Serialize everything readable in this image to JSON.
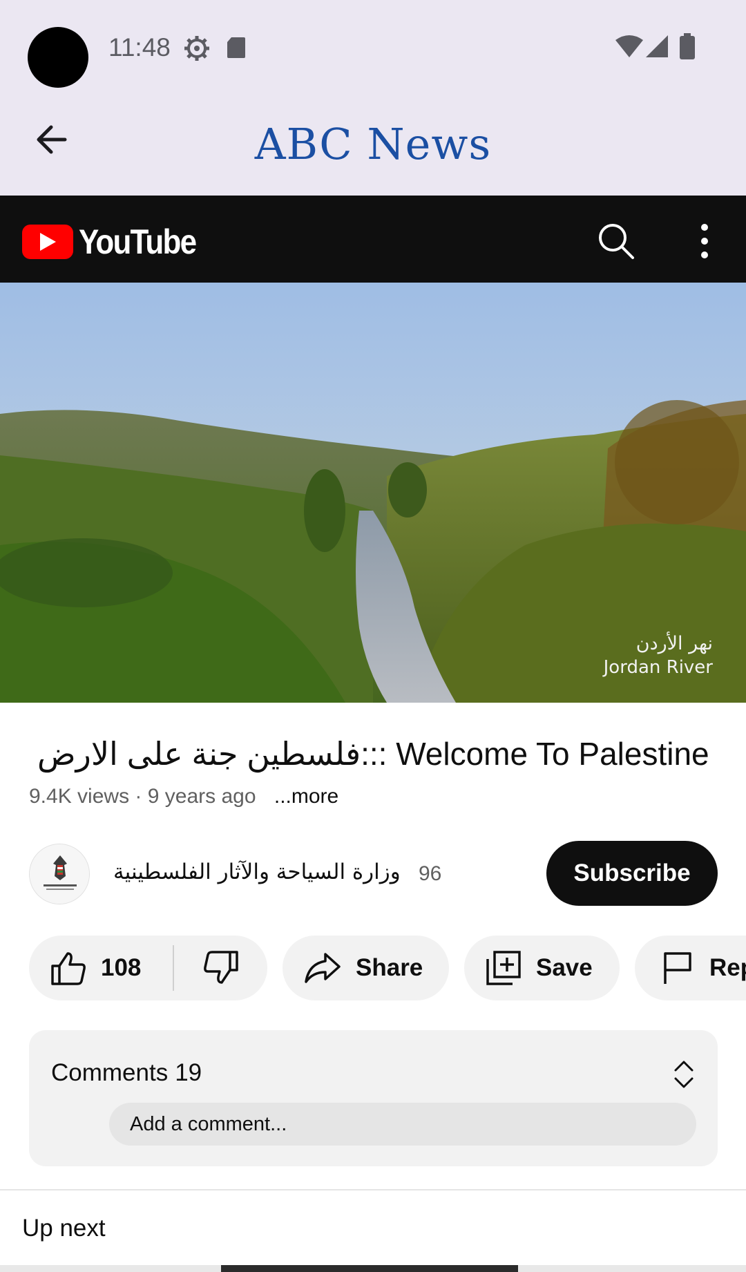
{
  "status_bar": {
    "time": "11:48",
    "icons": [
      "settings-icon",
      "sd-card-icon",
      "wifi-icon",
      "signal-icon",
      "battery-icon"
    ]
  },
  "app_bar": {
    "title": "ABC News",
    "title_color": "#1b4fa3",
    "background": "#ebe7f2"
  },
  "youtube_header": {
    "logo_text": "YouTube",
    "brand_color": "#ff0000"
  },
  "video": {
    "caption_ar": "نهر الأردن",
    "caption_en": "Jordan River"
  },
  "video_info": {
    "title": "فلسطين جنة على الارض::: Welcome To Palestine",
    "views": "9.4K views",
    "age": "9 years ago",
    "more_label": "...more"
  },
  "channel": {
    "name": "وزارة السياحة والآثار الفلسطينية",
    "subscriber_count": "96",
    "subscribe_label": "Subscribe"
  },
  "actions": {
    "like_count": "108",
    "share_label": "Share",
    "save_label": "Save",
    "report_label": "Rep"
  },
  "comments": {
    "label": "Comments",
    "count": "19",
    "placeholder": "Add a comment..."
  },
  "up_next": {
    "label": "Up next"
  }
}
